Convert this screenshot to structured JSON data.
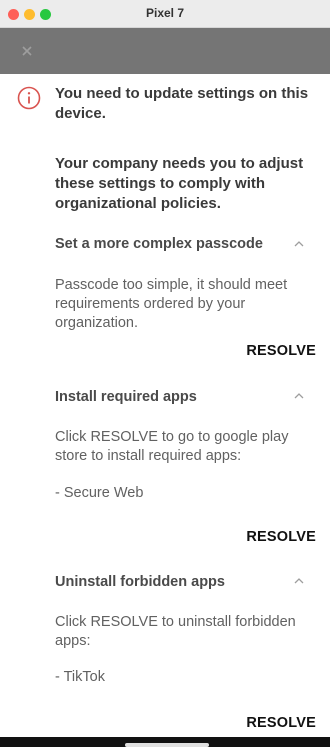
{
  "window": {
    "title": "Pixel 7"
  },
  "alert": {
    "heading": "You need to update settings on this device.",
    "intro": "Your company needs you to adjust these settings to comply with organizational policies."
  },
  "sections": [
    {
      "title": "Set a more complex passcode",
      "description": "Passcode too simple, it should meet requirements ordered by your organization.",
      "item": "",
      "action": "RESOLVE"
    },
    {
      "title": "Install required apps",
      "description": "Click RESOLVE to go to google play store to install required apps:",
      "item": "- Secure Web",
      "action": "RESOLVE"
    },
    {
      "title": "Uninstall forbidden apps",
      "description": "Click RESOLVE to uninstall forbidden apps:",
      "item": "- TikTok",
      "action": "RESOLVE"
    }
  ],
  "colors": {
    "alert_icon": "#d9534f",
    "appbar": "#757575",
    "titlebar": "#ececec"
  },
  "icons": {
    "appbar": "close-icon",
    "alert": "info-circle-icon",
    "section_toggle": "chevron-up-icon"
  }
}
